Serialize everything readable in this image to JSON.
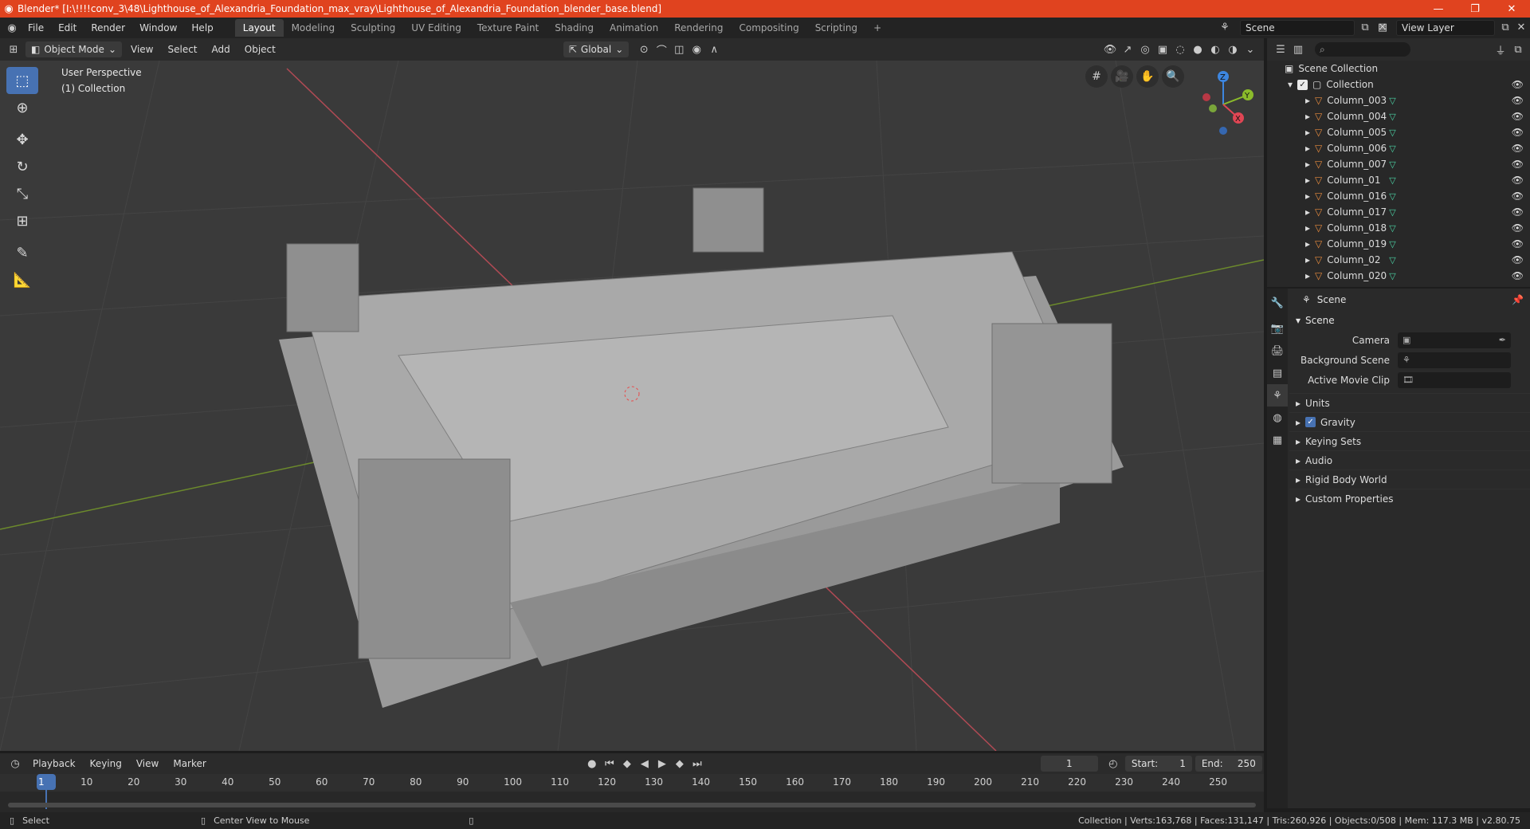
{
  "window": {
    "title": "Blender* [I:\\!!!!conv_3\\48\\Lighthouse_of_Alexandria_Foundation_max_vray\\Lighthouse_of_Alexandria_Foundation_blender_base.blend]",
    "minimize": "—",
    "maximize": "❐",
    "close": "✕"
  },
  "menus": [
    "File",
    "Edit",
    "Render",
    "Window",
    "Help"
  ],
  "workspaces": [
    "Layout",
    "Modeling",
    "Sculpting",
    "UV Editing",
    "Texture Paint",
    "Shading",
    "Animation",
    "Rendering",
    "Compositing",
    "Scripting"
  ],
  "active_workspace": "Layout",
  "add_workspace": "+",
  "scene_name": "Scene",
  "view_layer": "View Layer",
  "viewport": {
    "mode": "Object Mode",
    "menus": [
      "View",
      "Select",
      "Add",
      "Object"
    ],
    "orientation": "Global",
    "info_line1": "User Perspective",
    "info_line2": "(1) Collection",
    "gizmo": {
      "x": "X",
      "y": "Y",
      "z": "Z"
    }
  },
  "outliner": {
    "root": "Scene Collection",
    "collection": "Collection",
    "items": [
      "Column_003",
      "Column_004",
      "Column_005",
      "Column_006",
      "Column_007",
      "Column_01",
      "Column_016",
      "Column_017",
      "Column_018",
      "Column_019",
      "Column_02",
      "Column_020"
    ]
  },
  "properties": {
    "context": "Scene",
    "panel": "Scene",
    "camera_label": "Camera",
    "background_scene_label": "Background Scene",
    "active_movie_clip_label": "Active Movie Clip",
    "subpanels": [
      "Units",
      "Gravity",
      "Keying Sets",
      "Audio",
      "Rigid Body World",
      "Custom Properties"
    ],
    "gravity_checked": true
  },
  "timeline": {
    "menus": [
      "Playback",
      "Keying",
      "View",
      "Marker"
    ],
    "current_frame": "1",
    "start_label": "Start:",
    "start": "1",
    "end_label": "End:",
    "end": "250",
    "ticks": [
      "1",
      "10",
      "20",
      "30",
      "40",
      "50",
      "60",
      "70",
      "80",
      "90",
      "100",
      "110",
      "120",
      "130",
      "140",
      "150",
      "160",
      "170",
      "180",
      "190",
      "200",
      "210",
      "220",
      "230",
      "240",
      "250"
    ]
  },
  "status": {
    "left_action": "Select",
    "middle_action": "Center View to Mouse",
    "stats": "Collection | Verts:163,768 | Faces:131,147 | Tris:260,926 | Objects:0/508 | Mem: 117.3 MB | v2.80.75"
  },
  "colors": {
    "titlebar": "#e0431f",
    "accent": "#4772b3",
    "object_icon": "#e88b3e",
    "mesh_icon": "#4cd3a5",
    "axis_x": "#e04654",
    "axis_y": "#8bbb2b",
    "axis_z": "#3d86e0"
  }
}
